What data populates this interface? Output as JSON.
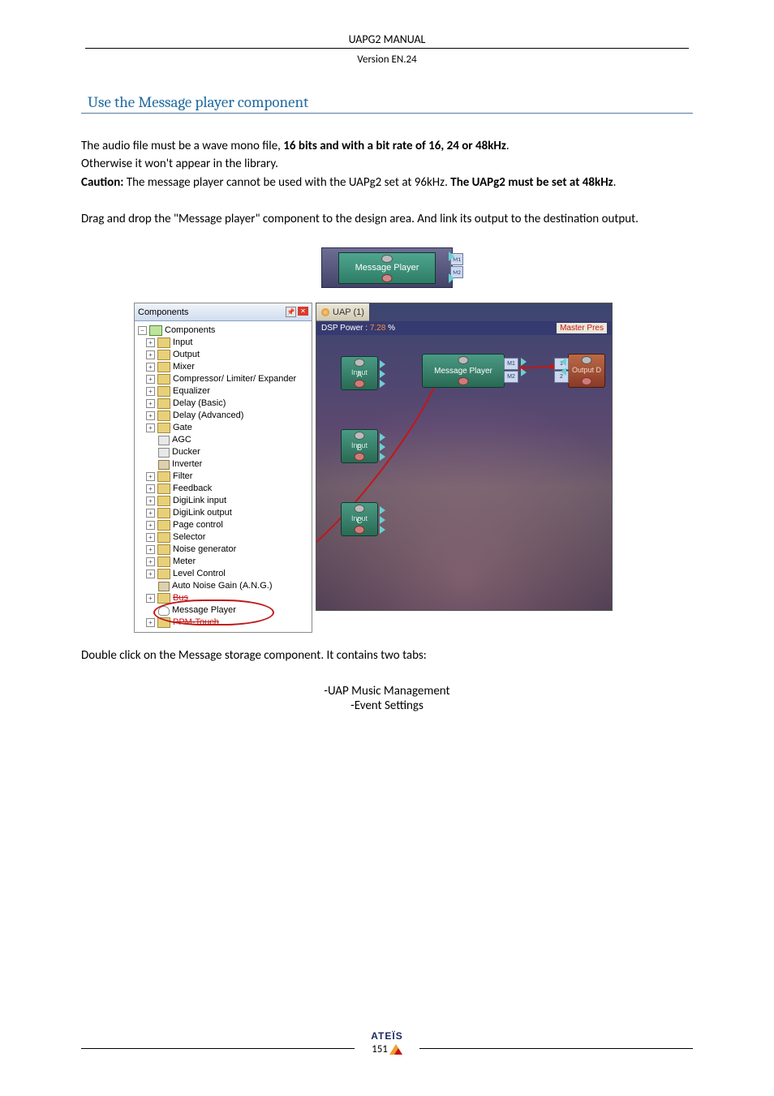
{
  "header": {
    "title": "UAPG2  MANUAL",
    "version": "Version EN.24"
  },
  "section_title": "Use the Message player component",
  "para1_a": "The audio file must be a wave mono file, ",
  "para1_bold": "16 bits and with a bit rate of 16, 24 or 48kHz",
  "para1_b": ".",
  "para2": "Otherwise it won't appear in the library.",
  "para3_a": "Caution:",
  "para3_b": " The message player cannot be used with the UAPg2 set at 96kHz. ",
  "para3_c": "The UAPg2 must be set at 48kHz",
  "para3_d": ".",
  "para4": "Drag and drop the \"Message player\" component to the design area. And link its output to the destination output.",
  "para5": "Double click on the Message storage component. It contains two tabs:",
  "tabs_list": {
    "a": "-UAP Music Management",
    "b": "-Event Settings"
  },
  "mp_small": {
    "label": "Message Player",
    "port1": "M1",
    "port2": "M2"
  },
  "components_panel": {
    "title": "Components",
    "root": "Components",
    "items": [
      "Input",
      "Output",
      "Mixer",
      "Compressor/ Limiter/ Expander",
      "Equalizer",
      "Delay (Basic)",
      "Delay (Advanced)",
      "Gate",
      "AGC",
      "Ducker",
      "Inverter",
      "Filter",
      "Feedback",
      "DigiLink input",
      "DigiLink output",
      "Page control",
      "Selector",
      "Noise generator",
      "Meter",
      "Level Control",
      "Auto Noise Gain (A.N.G.)",
      "Bus",
      "Message Player",
      "PPM-Touch"
    ]
  },
  "design": {
    "tab": "UAP (1)",
    "dsp_power_label": "DSP Power :",
    "dsp_power_value": "7.28",
    "dsp_power_pct": "%",
    "master_label": "Master Pres",
    "nodes": {
      "input_a": {
        "name": "Input",
        "sub": "A"
      },
      "input_b": {
        "name": "Input",
        "sub": "B"
      },
      "input_c": {
        "name": "Input",
        "sub": "C"
      },
      "mp": {
        "name": "Message Player",
        "p1": "M1",
        "p2": "M2"
      },
      "output_d": {
        "name": "Output",
        "sub": "D",
        "p1": "1",
        "p2": "2"
      }
    }
  },
  "footer": {
    "brand": "ATEÏS",
    "page_number": "151"
  }
}
